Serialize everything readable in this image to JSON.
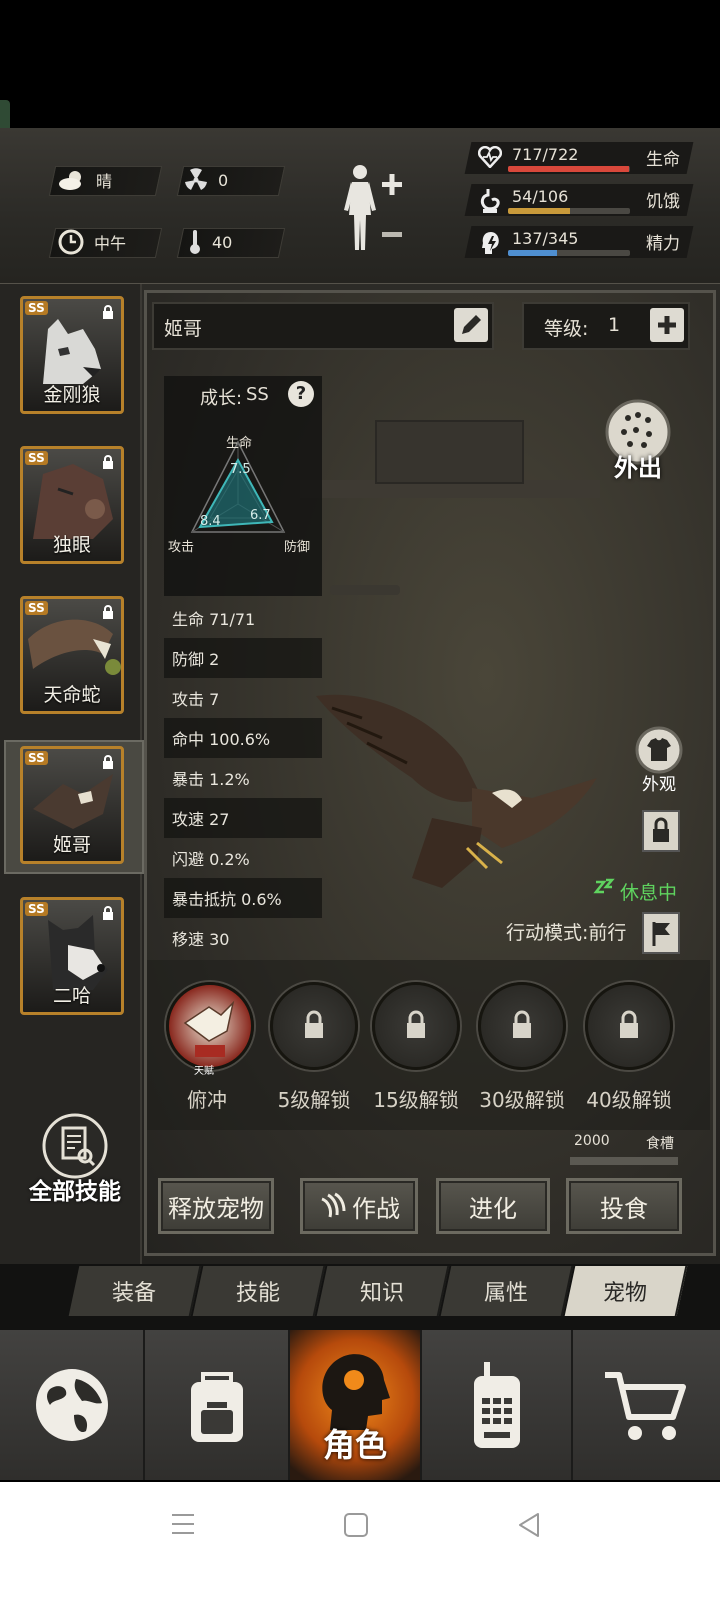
{
  "weather": {
    "condition": "晴",
    "radiation": "0",
    "time_of_day": "中午",
    "temperature": "40"
  },
  "vitals": [
    {
      "label": "生命",
      "value": "717/722",
      "fraction": 0.993,
      "color": "#d9483b",
      "icon": "heart-icon"
    },
    {
      "label": "饥饿",
      "value": "54/106",
      "fraction": 0.509,
      "color": "#c99a3a",
      "icon": "stomach-icon"
    },
    {
      "label": "精力",
      "value": "137/345",
      "fraction": 0.397,
      "color": "#4f8fd1",
      "icon": "energy-icon"
    }
  ],
  "pets": [
    {
      "name": "金刚狼",
      "rank": "SS"
    },
    {
      "name": "独眼",
      "rank": "SS"
    },
    {
      "name": "天命蛇",
      "rank": "SS"
    },
    {
      "name": "姬哥",
      "rank": "SS"
    },
    {
      "name": "二哈",
      "rank": "SS"
    }
  ],
  "all_skills_label": "全部技能",
  "pet_detail": {
    "name": "姬哥",
    "level_label": "等级:",
    "level_value": "1",
    "growth_label": "成长:",
    "growth_value": "SS",
    "radar": {
      "top_label": "生命",
      "left_label": "攻击",
      "right_label": "防御",
      "top_value": "7.5",
      "left_value": "8.4",
      "right_value": "6.7"
    },
    "stats": [
      "生命 71/71",
      "防御 2",
      "攻击 7",
      "命中 100.6%",
      "暴击 1.2%",
      "攻速 27",
      "闪避 0.2%",
      "暴击抵抗 0.6%",
      "移速 30"
    ],
    "go_out_label": "外出",
    "appearance_label": "外观",
    "status": "休息中",
    "action_mode": "行动模式:前行"
  },
  "skills": [
    {
      "label": "俯冲",
      "badge": "天赋",
      "locked": false
    },
    {
      "label": "5级解锁",
      "locked": true
    },
    {
      "label": "15级解锁",
      "locked": true
    },
    {
      "label": "30级解锁",
      "locked": true
    },
    {
      "label": "40级解锁",
      "locked": true
    }
  ],
  "food_trough": {
    "label": "食槽",
    "value": "2000"
  },
  "action_buttons": {
    "release": "释放宠物",
    "fight": "作战",
    "evolve": "进化",
    "feed": "投食"
  },
  "tabs": [
    "装备",
    "技能",
    "知识",
    "属性",
    "宠物"
  ],
  "active_tab": "宠物",
  "nav": {
    "character_label": "角色"
  }
}
